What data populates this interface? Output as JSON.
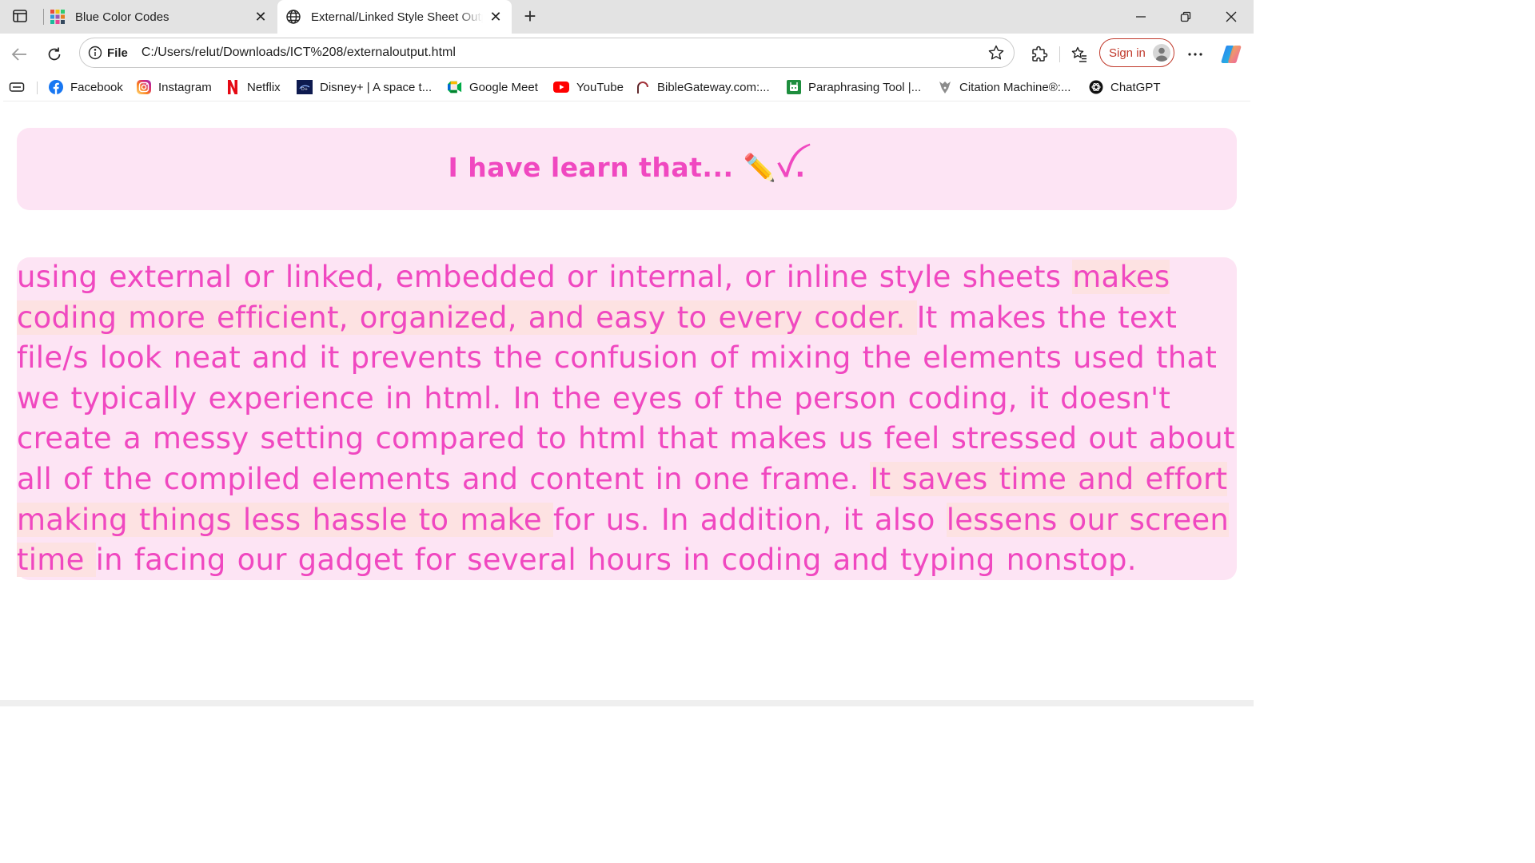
{
  "tabs": [
    {
      "title": "Blue Color Codes",
      "active": false
    },
    {
      "title": "External/Linked Style Sheet Output",
      "active": true
    }
  ],
  "address_bar": {
    "scheme_label": "File",
    "url": "C:/Users/relut/Downloads/ICT%208/externaloutput.html"
  },
  "toolbar": {
    "sign_in_label": "Sign in"
  },
  "bookmarks": [
    {
      "label": "Facebook",
      "icon": "facebook-icon"
    },
    {
      "label": "Instagram",
      "icon": "instagram-icon"
    },
    {
      "label": "Netflix",
      "icon": "netflix-icon"
    },
    {
      "label": "Disney+ | A space t...",
      "icon": "disney-plus-icon"
    },
    {
      "label": "Google Meet",
      "icon": "google-meet-icon"
    },
    {
      "label": "YouTube",
      "icon": "youtube-icon"
    },
    {
      "label": "BibleGateway.com:...",
      "icon": "biblegateway-icon"
    },
    {
      "label": "Paraphrasing Tool |...",
      "icon": "paraphrasing-tool-icon"
    },
    {
      "label": "Citation Machine®:...",
      "icon": "citation-machine-icon"
    },
    {
      "label": "ChatGPT",
      "icon": "chatgpt-icon"
    }
  ],
  "page": {
    "heading": "I have learn that... ✏️ꪜ.",
    "paragraph": [
      {
        "text": "using external or linked, embedded or internal, or inline style sheets ",
        "highlight": false
      },
      {
        "text": "makes coding more efficient, organized, and easy to every coder. ",
        "highlight": true
      },
      {
        "text": "It makes the text file/s look neat and it prevents the confusion of mixing the elements used that we typically experience in html. In the eyes of the person coding, it doesn't create a messy setting compared to html that makes us feel stressed out about all of the compiled elements and content in one frame. ",
        "highlight": false
      },
      {
        "text": "It saves time and effort making things less hassle to make ",
        "highlight": true
      },
      {
        "text": "for us. In addition, it also ",
        "highlight": false
      },
      {
        "text": "lessens our screen time ",
        "highlight": true
      },
      {
        "text": "in facing our gadget for several hours in coding and typing nonstop.",
        "highlight": false
      }
    ]
  },
  "colors": {
    "text_pink": "#f048c0",
    "box_background": "#fde4f4",
    "highlight_background": "#fde2e2",
    "sign_in_red": "#c0392b"
  }
}
